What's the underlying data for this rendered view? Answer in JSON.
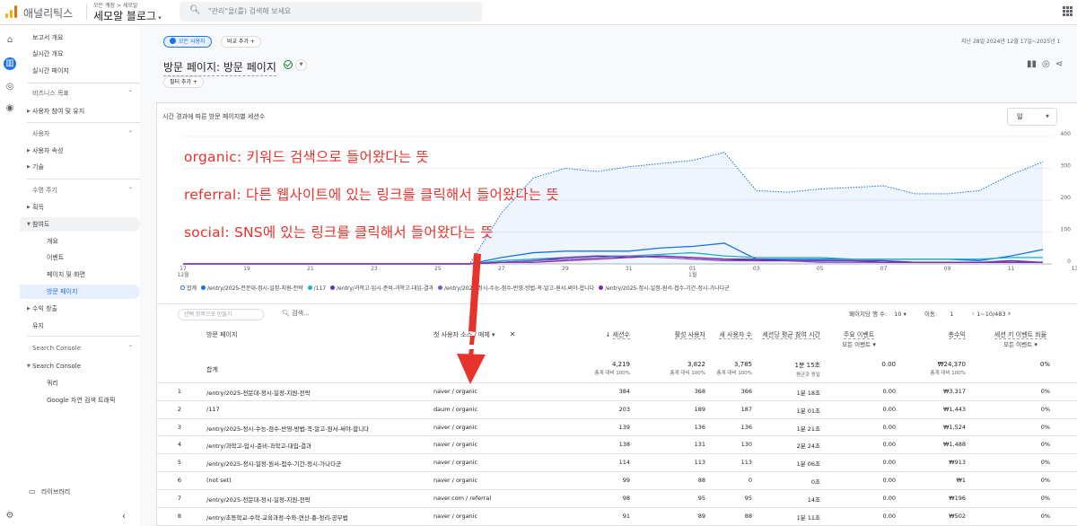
{
  "app": {
    "name": "애널리틱스",
    "account_path": "모든 계정 > 세모알",
    "property": "세모알 블로그"
  },
  "search": {
    "placeholder": "\"관리\"을(를) 검색해 보세요"
  },
  "sidebar": {
    "items": [
      {
        "label": "보고서 개요"
      },
      {
        "label": "실시간 개요"
      },
      {
        "label": "실시간 페이지"
      },
      {
        "label": "비즈니스 목표"
      },
      {
        "label": "사용자 참여 및 유지"
      },
      {
        "label": "사용자"
      },
      {
        "label": "사용자 속성"
      },
      {
        "label": "기술"
      },
      {
        "label": "수명 주기"
      },
      {
        "label": "획득"
      },
      {
        "label": "참여도"
      },
      {
        "label": "개요"
      },
      {
        "label": "이벤트"
      },
      {
        "label": "페이지 및 화면"
      },
      {
        "label": "방문 페이지"
      },
      {
        "label": "수익 창출"
      },
      {
        "label": "유지"
      },
      {
        "label": "Search Console"
      },
      {
        "label": "Search Console"
      },
      {
        "label": "쿼리"
      },
      {
        "label": "Google 자연 검색 트래픽"
      },
      {
        "label": "라이브러리"
      }
    ]
  },
  "toolbar": {
    "segment_chip": "모든 사용자",
    "compare_chip": "비교 추가 +",
    "date_range": "지난 28일  2024년 12월 17일~2025년 1",
    "filter_chip": "필터 추가 +"
  },
  "page": {
    "title": "방문 페이지: 방문 페이지"
  },
  "chart_card": {
    "title": "시간 경과에 따른 방문 페이지별 세션수",
    "granularity": "일"
  },
  "chart_data": {
    "type": "line",
    "x": [
      "12월 17일",
      "12월 18일",
      "12월 19일",
      "12월 20일",
      "12월 21일",
      "12월 22일",
      "12월 23일",
      "12월 24일",
      "12월 25일",
      "12월 26일",
      "12월 27일",
      "12월 28일",
      "12월 29일",
      "12월 30일",
      "12월 31일",
      "1월 1일",
      "1월 2일",
      "1월 3일",
      "1월 4일",
      "1월 5일",
      "1월 6일",
      "1월 7일",
      "1월 8일",
      "1월 9일",
      "1월 10일",
      "1월 11일",
      "1월 12일",
      "1월 13일"
    ],
    "x_tick_labels": [
      "17\n12월",
      "19",
      "21",
      "23",
      "25",
      "27",
      "29",
      "31",
      "01\n1월",
      "03",
      "05",
      "07",
      "09",
      "11",
      "13"
    ],
    "y_tick_labels": [
      "400",
      "300",
      "200",
      "100",
      "0"
    ],
    "ylim": [
      0,
      400
    ],
    "series": [
      {
        "name": "합계",
        "color": "#1a73e8",
        "style": "dotted-area",
        "values": [
          0,
          0,
          0,
          0,
          0,
          0,
          0,
          0,
          0,
          0,
          160,
          270,
          300,
          290,
          305,
          315,
          325,
          350,
          230,
          225,
          235,
          240,
          245,
          220,
          220,
          230,
          280,
          320
        ]
      },
      {
        "name": "/entry/2025-전문대-정시-일정-지원-전략",
        "color": "#1a73e8",
        "values": [
          0,
          0,
          0,
          0,
          0,
          0,
          0,
          0,
          0,
          0,
          20,
          35,
          40,
          40,
          40,
          50,
          55,
          65,
          15,
          15,
          15,
          15,
          15,
          15,
          15,
          10,
          25,
          45
        ]
      },
      {
        "name": "/117",
        "color": "#12b5cb",
        "values": [
          0,
          0,
          0,
          0,
          0,
          0,
          0,
          0,
          0,
          0,
          10,
          15,
          20,
          25,
          25,
          30,
          35,
          25,
          20,
          20,
          20,
          15,
          15,
          15,
          15,
          15,
          20,
          20
        ]
      },
      {
        "name": "/entry/과학고-입시-준비-과학고-대입-결과",
        "color": "#5e35b1",
        "values": [
          0,
          0,
          0,
          0,
          0,
          0,
          0,
          0,
          0,
          0,
          5,
          10,
          20,
          25,
          20,
          25,
          20,
          15,
          15,
          10,
          10,
          10,
          10,
          5,
          5,
          5,
          10,
          5
        ]
      },
      {
        "name": "/entry/2025-정시-수능-점수-반영-방법-꼭-알고-원서-써야-합니다",
        "color": "#7e57c2",
        "values": [
          0,
          0,
          0,
          0,
          0,
          0,
          0,
          0,
          0,
          0,
          5,
          10,
          15,
          20,
          25,
          20,
          15,
          10,
          10,
          10,
          5,
          5,
          5,
          5,
          5,
          5,
          5,
          5
        ]
      },
      {
        "name": "/entry/2025-정시-일정-원서-접수-기간-정시-가나다군",
        "color": "#8e24aa",
        "values": [
          0,
          0,
          0,
          0,
          0,
          0,
          0,
          0,
          0,
          0,
          5,
          5,
          10,
          15,
          20,
          25,
          20,
          15,
          10,
          10,
          10,
          10,
          5,
          5,
          5,
          5,
          5,
          5
        ]
      }
    ]
  },
  "annotations": [
    "organic: 키워드 검색으로 들어왔다는 뜻",
    "referral: 다른 웹사이트에 있는 링크를 클릭해서 들어왔다는 뜻",
    "social: SNS에 있는 링크를 클릭해서 들어왔다는 뜻"
  ],
  "table": {
    "segment_placeholder": "선택 항목으로 만들기",
    "search_placeholder": "검색...",
    "rows_per_page_label": "페이지당 행 수:",
    "rows_per_page": "10",
    "goto_label": "이동:",
    "goto_value": "1",
    "range": "1~10/483",
    "columns": {
      "landing": "방문 페이지",
      "source": "첫 사용자 소스 / 매체",
      "sessions": "세션수",
      "active_users": "활성 사용자",
      "new_users": "새 사용자 수",
      "avg_engagement": "세션당 평균 참여 시간",
      "key_events": "주요 이벤트",
      "key_events_sub": "모든 이벤트",
      "revenue": "총수익",
      "session_key_rate": "세션 키 이벤트 비율",
      "session_key_rate_sub": "모든 이벤트"
    },
    "totals": {
      "label": "합계",
      "sessions": "4,219",
      "sessions_sub": "총계 대비 100%",
      "active_users": "3,822",
      "active_users_sub": "총계 대비 100%",
      "new_users": "3,785",
      "new_users_sub": "총계 대비 100%",
      "avg_engagement": "1분 15초",
      "avg_engagement_sub": "평균과 동일",
      "key_events": "0.00",
      "revenue": "₩24,370",
      "revenue_sub": "총계 대비 100%",
      "session_key_rate": "0%"
    },
    "rows": [
      {
        "n": "1",
        "page": "/entry/2025-전문대-정시-일정-지원-전략",
        "source": "naver / organic",
        "sessions": "384",
        "active": "368",
        "new": "366",
        "avg": "1분 18초",
        "key": "0.00",
        "rev": "₩3,317",
        "rate": "0%"
      },
      {
        "n": "2",
        "page": "/117",
        "source": "daum / organic",
        "sessions": "203",
        "active": "189",
        "new": "187",
        "avg": "1분 01초",
        "key": "0.00",
        "rev": "₩1,443",
        "rate": "0%"
      },
      {
        "n": "3",
        "page": "/entry/2025-정시-수능-점수-반영-방법-꼭-알고-원서-써야-합니다",
        "source": "naver / organic",
        "sessions": "139",
        "active": "136",
        "new": "136",
        "avg": "1분 21초",
        "key": "0.00",
        "rev": "₩1,524",
        "rate": "0%"
      },
      {
        "n": "4",
        "page": "/entry/과학고-입시-준비-과학고-대입-결과",
        "source": "naver / organic",
        "sessions": "138",
        "active": "131",
        "new": "130",
        "avg": "2분 24초",
        "key": "0.00",
        "rev": "₩1,488",
        "rate": "0%"
      },
      {
        "n": "5",
        "page": "/entry/2025-정시-일정-원서-접수-기간-정시-가나다군",
        "source": "naver / organic",
        "sessions": "114",
        "active": "113",
        "new": "113",
        "avg": "1분 06초",
        "key": "0.00",
        "rev": "₩913",
        "rate": "0%"
      },
      {
        "n": "6",
        "page": "(not set)",
        "source": "naver / organic",
        "sessions": "99",
        "active": "88",
        "new": "0",
        "avg": "0초",
        "key": "0.00",
        "rev": "₩1",
        "rate": "0%"
      },
      {
        "n": "7",
        "page": "/entry/2025-전문대-정시-일정-지원-전략",
        "source": "naver.com / referral",
        "sessions": "98",
        "active": "95",
        "new": "95",
        "avg": "14초",
        "key": "0.00",
        "rev": "₩196",
        "rate": "0%"
      },
      {
        "n": "8",
        "page": "/entry/초등학교-수학-교육과정-수와-연산-총-정리-공부법",
        "source": "naver / organic",
        "sessions": "91",
        "active": "89",
        "new": "88",
        "avg": "1분 11초",
        "key": "0.00",
        "rev": "₩502",
        "rate": "0%"
      }
    ]
  },
  "colors": {
    "accent": "#1a73e8",
    "annotation": "#e8322c",
    "logo": "#f9ab00"
  }
}
